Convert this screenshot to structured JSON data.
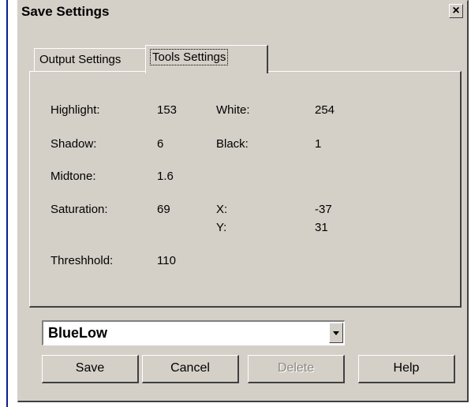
{
  "window": {
    "title": "Save Settings",
    "close_label": "×"
  },
  "tabs": [
    {
      "label": "Output Settings"
    },
    {
      "label": "Tools Settings"
    }
  ],
  "settings": {
    "highlight": {
      "label": "Highlight:",
      "value": "153"
    },
    "white": {
      "label": "White:",
      "value": "254"
    },
    "shadow": {
      "label": "Shadow:",
      "value": "6"
    },
    "black": {
      "label": "Black:",
      "value": "1"
    },
    "midtone": {
      "label": "Midtone:",
      "value": "1.6"
    },
    "saturation": {
      "label": "Saturation:",
      "value": "69"
    },
    "x": {
      "label": "X:",
      "value": "-37"
    },
    "y": {
      "label": "Y:",
      "value": "31"
    },
    "threshold": {
      "label": "Threshhold:",
      "value": "110"
    }
  },
  "preset": {
    "selected": "BlueLow"
  },
  "buttons": {
    "save": "Save",
    "cancel": "Cancel",
    "delete": "Delete",
    "help": "Help"
  }
}
